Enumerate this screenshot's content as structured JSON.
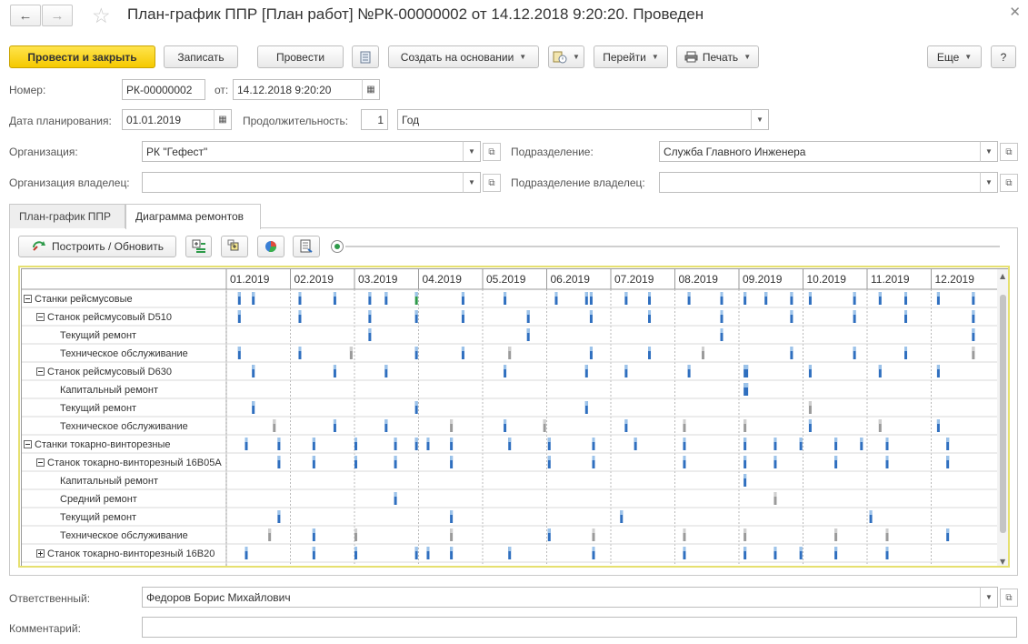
{
  "window": {
    "title": "План-график ППР [План работ] №РК-00000002 от 14.12.2018 9:20:20. Проведен",
    "back_glyph": "←",
    "forward_glyph": "→",
    "star_glyph": "☆",
    "close_glyph": "✕"
  },
  "toolbar": {
    "post_close": "Провести и закрыть",
    "save": "Записать",
    "post": "Провести",
    "create_based": "Создать на основании",
    "goto": "Перейти",
    "print": "Печать",
    "more": "Еще",
    "help": "?"
  },
  "form": {
    "number_label": "Номер:",
    "number_value": "РК-00000002",
    "from_label": "от:",
    "date_value": "14.12.2018  9:20:20",
    "plan_date_label": "Дата планирования:",
    "plan_date_value": "01.01.2019",
    "duration_label": "Продолжительность:",
    "duration_value": "1",
    "period_value": "Год",
    "org_label": "Организация:",
    "org_value": "РК \"Гефест\"",
    "dept_label": "Подразделение:",
    "dept_value": "Служба Главного Инженера",
    "org_owner_label": "Организация владелец:",
    "org_owner_value": "",
    "dept_owner_label": "Подразделение владелец:",
    "dept_owner_value": "",
    "responsible_label": "Ответственный:",
    "responsible_value": "Федоров Борис Михайлович",
    "comment_label": "Комментарий:",
    "comment_value": ""
  },
  "tabs": {
    "plan": "План-график ППР",
    "diagram": "Диаграмма ремонтов"
  },
  "panel": {
    "build_button": "Построить / Обновить"
  },
  "gantt": {
    "months": [
      "01.2019",
      "02.2019",
      "03.2019",
      "04.2019",
      "05.2019",
      "06.2019",
      "07.2019",
      "08.2019",
      "09.2019",
      "10.2019",
      "11.2019",
      "12.2019"
    ],
    "rows": [
      {
        "label": "Станки рейсмусовые",
        "level": 0,
        "toggle": "−"
      },
      {
        "label": "Станок рейсмусовый D510",
        "level": 1,
        "toggle": "−"
      },
      {
        "label": "Текущий ремонт",
        "level": 2,
        "toggle": ""
      },
      {
        "label": "Техническое обслуживание",
        "level": 2,
        "toggle": ""
      },
      {
        "label": "Станок рейсмусовый D630",
        "level": 1,
        "toggle": "−"
      },
      {
        "label": "Капитальный ремонт",
        "level": 2,
        "toggle": ""
      },
      {
        "label": "Текущий ремонт",
        "level": 2,
        "toggle": ""
      },
      {
        "label": "Техническое обслуживание",
        "level": 2,
        "toggle": ""
      },
      {
        "label": "Станки токарно-винторезные",
        "level": 0,
        "toggle": "−"
      },
      {
        "label": "Станок токарно-винторезный 16В05А",
        "level": 1,
        "toggle": "−"
      },
      {
        "label": "Капитальный ремонт",
        "level": 2,
        "toggle": ""
      },
      {
        "label": "Средний ремонт",
        "level": 2,
        "toggle": ""
      },
      {
        "label": "Текущий ремонт",
        "level": 2,
        "toggle": ""
      },
      {
        "label": "Техническое обслуживание",
        "level": 2,
        "toggle": ""
      },
      {
        "label": "Станок токарно-винторезный 16В20",
        "level": 1,
        "toggle": "+"
      }
    ],
    "colors": {
      "bar": "#2f6fbf",
      "bar_light": "#9cc3ea",
      "bar_gray": "#9a9a9a",
      "bar_green": "#2e9a4a",
      "grid": "#d8d8d8",
      "header_bg": "#ffffff"
    },
    "markers": [
      [
        [
          0.5,
          "b"
        ],
        [
          1.1,
          "b"
        ],
        [
          3.1,
          "b"
        ],
        [
          4.6,
          "b"
        ],
        [
          6.1,
          "b"
        ],
        [
          6.8,
          "b"
        ],
        [
          8.1,
          "g"
        ],
        [
          10.1,
          "b"
        ],
        [
          11.9,
          "b"
        ],
        [
          14.1,
          "b"
        ],
        [
          15.4,
          "b"
        ],
        [
          15.6,
          "b"
        ],
        [
          17.1,
          "b"
        ],
        [
          18.1,
          "b"
        ],
        [
          19.8,
          "b"
        ],
        [
          21.2,
          "b"
        ],
        [
          22.2,
          "b"
        ],
        [
          23.1,
          "b"
        ],
        [
          24.2,
          "b"
        ],
        [
          25.0,
          "b"
        ],
        [
          26.9,
          "b"
        ],
        [
          28.0,
          "b"
        ],
        [
          29.1,
          "b"
        ],
        [
          30.5,
          "b"
        ],
        [
          32.0,
          "b"
        ]
      ],
      [
        [
          0.5,
          "b"
        ],
        [
          3.1,
          "b"
        ],
        [
          6.1,
          "b"
        ],
        [
          8.1,
          "b"
        ],
        [
          10.1,
          "b"
        ],
        [
          12.9,
          "b"
        ],
        [
          15.6,
          "b"
        ],
        [
          18.1,
          "b"
        ],
        [
          21.2,
          "b"
        ],
        [
          24.2,
          "b"
        ],
        [
          26.9,
          "b"
        ],
        [
          29.1,
          "b"
        ],
        [
          32.0,
          "b"
        ]
      ],
      [
        [
          6.1,
          "b"
        ],
        [
          12.9,
          "b"
        ],
        [
          21.2,
          "b"
        ],
        [
          32.0,
          "b"
        ]
      ],
      [
        [
          0.5,
          "b"
        ],
        [
          3.1,
          "b"
        ],
        [
          5.3,
          "x"
        ],
        [
          8.1,
          "b"
        ],
        [
          10.1,
          "b"
        ],
        [
          12.1,
          "x"
        ],
        [
          15.6,
          "b"
        ],
        [
          18.1,
          "b"
        ],
        [
          20.4,
          "x"
        ],
        [
          24.2,
          "b"
        ],
        [
          26.9,
          "b"
        ],
        [
          29.1,
          "b"
        ],
        [
          32.0,
          "x"
        ]
      ],
      [
        [
          1.1,
          "b"
        ],
        [
          4.6,
          "b"
        ],
        [
          6.8,
          "b"
        ],
        [
          11.9,
          "b"
        ],
        [
          15.4,
          "b"
        ],
        [
          17.1,
          "b"
        ],
        [
          19.8,
          "b"
        ],
        [
          22.2,
          "b"
        ],
        [
          25.0,
          "b"
        ],
        [
          28.0,
          "b"
        ],
        [
          30.5,
          "b"
        ]
      ],
      [
        [
          22.2,
          "b"
        ]
      ],
      [
        [
          1.1,
          "b"
        ],
        [
          8.1,
          "b"
        ],
        [
          15.4,
          "b"
        ],
        [
          25.0,
          "x"
        ]
      ],
      [
        [
          2.0,
          "x"
        ],
        [
          4.6,
          "b"
        ],
        [
          6.8,
          "b"
        ],
        [
          9.6,
          "x"
        ],
        [
          11.9,
          "b"
        ],
        [
          13.6,
          "x"
        ],
        [
          17.1,
          "b"
        ],
        [
          19.6,
          "x"
        ],
        [
          22.2,
          "x"
        ],
        [
          25.0,
          "b"
        ],
        [
          28.0,
          "x"
        ],
        [
          30.5,
          "b"
        ]
      ],
      [
        [
          0.8,
          "b"
        ],
        [
          2.2,
          "b"
        ],
        [
          3.7,
          "b"
        ],
        [
          5.5,
          "b"
        ],
        [
          7.2,
          "b"
        ],
        [
          8.1,
          "b"
        ],
        [
          8.6,
          "b"
        ],
        [
          9.6,
          "b"
        ],
        [
          12.1,
          "b"
        ],
        [
          13.8,
          "b"
        ],
        [
          15.7,
          "b"
        ],
        [
          17.5,
          "b"
        ],
        [
          19.6,
          "b"
        ],
        [
          22.2,
          "b"
        ],
        [
          23.5,
          "b"
        ],
        [
          24.6,
          "b"
        ],
        [
          26.1,
          "b"
        ],
        [
          27.2,
          "b"
        ],
        [
          28.3,
          "b"
        ],
        [
          30.9,
          "b"
        ]
      ],
      [
        [
          2.2,
          "b"
        ],
        [
          3.7,
          "b"
        ],
        [
          5.5,
          "b"
        ],
        [
          7.2,
          "b"
        ],
        [
          9.6,
          "b"
        ],
        [
          13.8,
          "b"
        ],
        [
          15.7,
          "b"
        ],
        [
          19.6,
          "b"
        ],
        [
          22.2,
          "b"
        ],
        [
          23.5,
          "b"
        ],
        [
          26.1,
          "b"
        ],
        [
          28.3,
          "b"
        ],
        [
          30.9,
          "b"
        ]
      ],
      [
        [
          22.2,
          "b"
        ]
      ],
      [
        [
          7.2,
          "b"
        ],
        [
          23.5,
          "x"
        ]
      ],
      [
        [
          2.2,
          "b"
        ],
        [
          9.6,
          "b"
        ],
        [
          16.9,
          "b"
        ],
        [
          27.6,
          "b"
        ]
      ],
      [
        [
          1.8,
          "x"
        ],
        [
          3.7,
          "b"
        ],
        [
          5.5,
          "x"
        ],
        [
          9.6,
          "x"
        ],
        [
          13.8,
          "b"
        ],
        [
          15.7,
          "x"
        ],
        [
          19.6,
          "x"
        ],
        [
          22.2,
          "x"
        ],
        [
          26.1,
          "x"
        ],
        [
          28.3,
          "x"
        ],
        [
          30.9,
          "b"
        ]
      ],
      [
        [
          0.8,
          "b"
        ],
        [
          3.7,
          "b"
        ],
        [
          5.5,
          "b"
        ],
        [
          8.1,
          "b"
        ],
        [
          8.6,
          "b"
        ],
        [
          9.6,
          "b"
        ],
        [
          12.1,
          "b"
        ],
        [
          15.7,
          "b"
        ],
        [
          19.6,
          "b"
        ],
        [
          22.2,
          "b"
        ],
        [
          23.5,
          "b"
        ],
        [
          24.6,
          "b"
        ],
        [
          26.1,
          "b"
        ],
        [
          28.3,
          "b"
        ]
      ]
    ]
  }
}
